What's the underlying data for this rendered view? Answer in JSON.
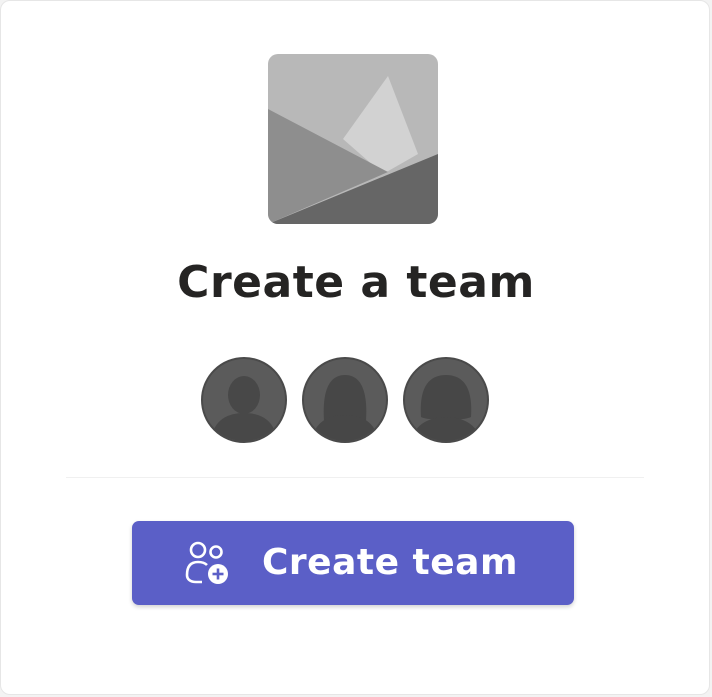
{
  "card": {
    "title": "Create a team",
    "image_icon": "team-placeholder-image-icon",
    "avatars": [
      {
        "icon": "person-avatar-icon"
      },
      {
        "icon": "person-avatar-icon"
      },
      {
        "icon": "person-avatar-icon"
      }
    ],
    "create_button": {
      "label": "Create team",
      "icon": "people-add-icon",
      "color": "#5b5fc7"
    }
  }
}
